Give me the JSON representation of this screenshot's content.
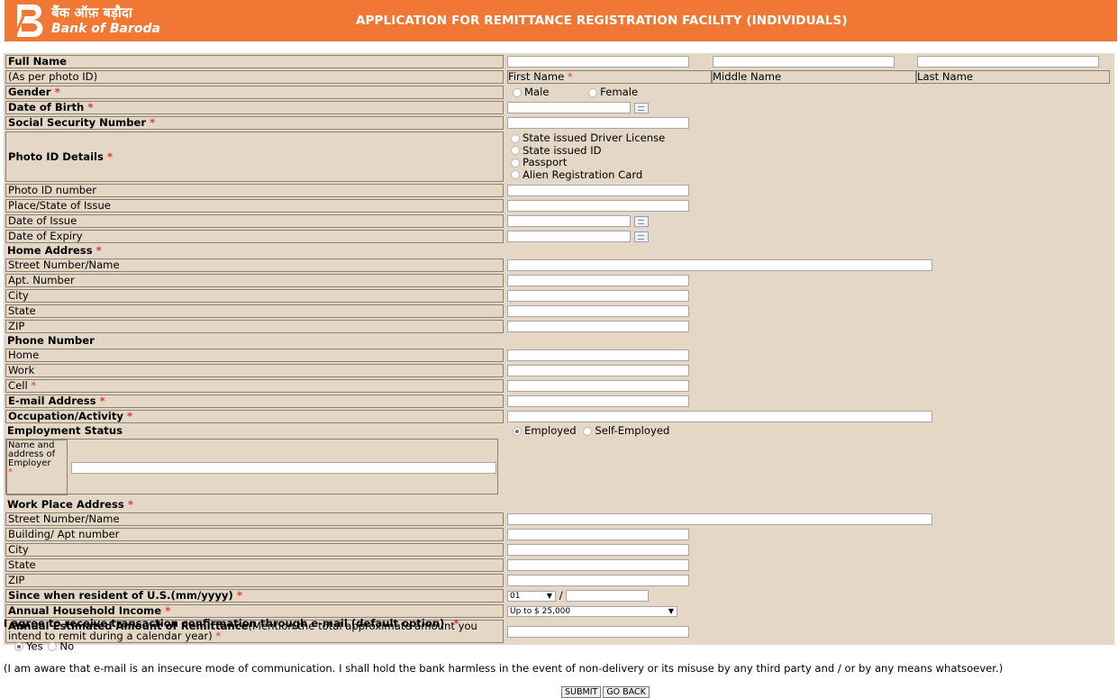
{
  "header": {
    "brand_hindi": "बैंक ऑफ़ बड़ौदा",
    "brand_english": "Bank of Baroda",
    "title": "APPLICATION FOR REMITTANCE REGISTRATION FACILITY (INDIVIDUALS)",
    "color": "#f07834"
  },
  "form": {
    "full_name": "Full Name",
    "as_per_photo": "(As per photo ID)",
    "first_name": "First Name",
    "middle_name": "Middle Name",
    "last_name": "Last Name",
    "gender": "Gender",
    "male": "Male",
    "female": "Female",
    "dob": "Date of Birth",
    "ssn": "Social Security Number",
    "photo_id_details": "Photo ID Details",
    "pid_options": [
      "State issued Driver License",
      "State issued ID",
      "Passport",
      "Alien Registration Card"
    ],
    "photo_id_number": "Photo ID number",
    "place_of_issue": "Place/State of Issue",
    "date_of_issue": "Date of Issue",
    "date_of_expiry": "Date of Expiry",
    "home_address": "Home Address",
    "street": "Street Number/Name",
    "apt": "Apt. Number",
    "city": "City",
    "state": "State",
    "zip": "ZIP",
    "phone_number": "Phone Number",
    "home": "Home",
    "work": "Work",
    "cell": "Cell",
    "email": "E-mail Address",
    "occupation": "Occupation/Activity",
    "employment_status": "Employment Status",
    "employed": "Employed",
    "self_employed": "Self-Employed",
    "employer_name": "Name and address of Employer",
    "work_address": "Work Place Address",
    "building": "Building/ Apt number",
    "since_resident": "Since when resident of U.S.(mm/yyyy)",
    "month_value": "01",
    "slash": "/",
    "income": "Annual Household Income",
    "income_value": "Up to $ 25,000",
    "remit_bold": "Annual Estimated Amount of Remittance",
    "remit_note": "(Mention the total approximate amount you intend to remit during a calendar year)",
    "required_mark": "*"
  },
  "consent": {
    "question": "I agree to receive transaction confirmation through e-mail (default option)",
    "yes": "Yes",
    "no": "No",
    "disclaimer": "(I am aware that e-mail is an insecure mode of communication. I shall hold the bank harmless in the event of non-delivery or its misuse by any third party and / or by any means whatsoever.)"
  },
  "buttons": {
    "submit": "SUBMIT",
    "go_back": "GO BACK"
  }
}
